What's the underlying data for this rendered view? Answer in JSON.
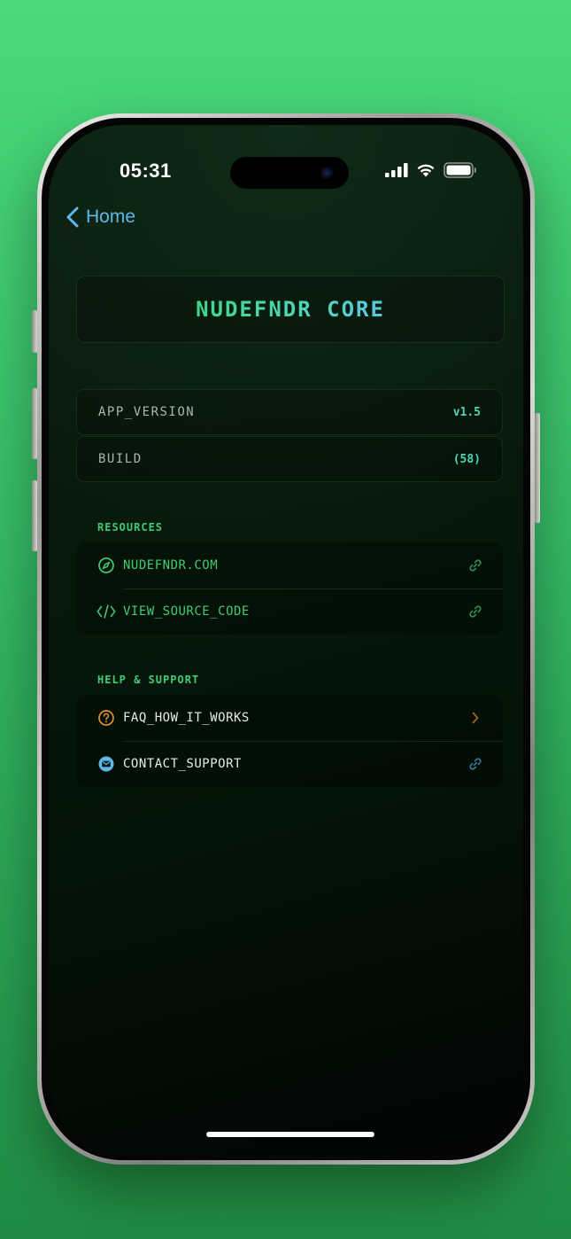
{
  "status_bar": {
    "time": "05:31"
  },
  "nav": {
    "back_label": "Home"
  },
  "header": {
    "title": "NUDEFNDR CORE"
  },
  "info": [
    {
      "label": "APP_VERSION",
      "value": "v1.5"
    },
    {
      "label": "BUILD",
      "value": "(58)"
    }
  ],
  "resources": {
    "title": "RESOURCES",
    "items": [
      {
        "label": "NUDEFNDR.COM",
        "icon": "compass-icon",
        "trail": "link-icon"
      },
      {
        "label": "VIEW_SOURCE_CODE",
        "icon": "code-icon",
        "trail": "link-icon"
      }
    ]
  },
  "help": {
    "title": "HELP & SUPPORT",
    "items": [
      {
        "label": "FAQ_HOW_IT_WORKS",
        "icon": "question-icon",
        "trail": "chevron-right-icon"
      },
      {
        "label": "CONTACT_SUPPORT",
        "icon": "envelope-icon",
        "trail": "link-icon"
      }
    ]
  },
  "colors": {
    "accent_green": "#3fcc72",
    "accent_teal": "#4fd6b6",
    "accent_blue": "#5fb8ec",
    "accent_orange": "#e0902a",
    "background": "#06190b"
  }
}
